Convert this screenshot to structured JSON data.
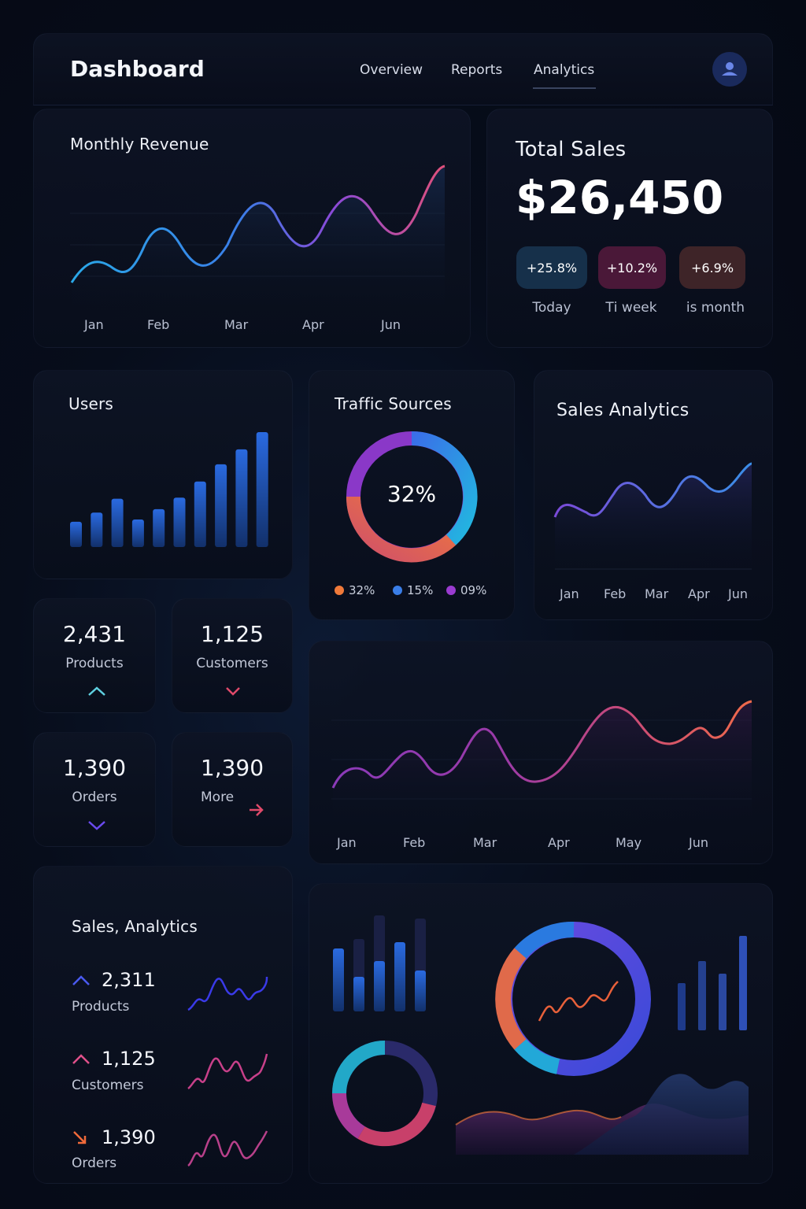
{
  "header": {
    "title": "Dashboard",
    "nav": [
      "Overview",
      "Reports",
      "Analytics"
    ],
    "active_nav": "Analytics",
    "avatar_icon": "user-icon"
  },
  "monthly_revenue": {
    "title": "Monthly Revenue",
    "months": [
      "Jan",
      "Feb",
      "Mar",
      "Apr",
      "Jun"
    ]
  },
  "total_sales": {
    "title": "Total Sales",
    "value": "$26,450",
    "changes": [
      {
        "value": "+25.8%",
        "label": "Today",
        "color": "#16304a"
      },
      {
        "value": "+10.2%",
        "label": "Ti̇ week",
        "color": "#4a1838"
      },
      {
        "value": "+6.9%",
        "label": "is month",
        "color": "#3e2428"
      }
    ]
  },
  "users": {
    "title": "Users",
    "bar_levels": [
      0.22,
      0.3,
      0.42,
      0.24,
      0.33,
      0.43,
      0.57,
      0.72,
      0.85,
      1.0
    ]
  },
  "traffic_sources": {
    "title": "Traffic Sources",
    "center_value": "32%",
    "legend": [
      {
        "label": "32%",
        "color": "#f07a3a"
      },
      {
        "label": "15%",
        "color": "#3a7ee8"
      },
      {
        "label": "09%",
        "color": "#9a3bd0"
      }
    ]
  },
  "sales_analytics_chart": {
    "title": "Sales Analytics",
    "months": [
      "Jan",
      "Feb",
      "Mar",
      "Apr",
      "Jun"
    ]
  },
  "stats": [
    {
      "value": "2,431",
      "label": "Products",
      "icon": "chevron-up-icon",
      "color": "#5fd0e0"
    },
    {
      "value": "1,125",
      "label": "Customers",
      "icon": "chevron-down-icon",
      "color": "#e04a6a"
    },
    {
      "value": "1,390",
      "label": "Orders",
      "icon": "chevron-down-icon",
      "color": "#6a4af0"
    },
    {
      "value": "1,390",
      "label": "More",
      "icon": "arrow-right-icon",
      "color": "#e04a6a"
    }
  ],
  "wide_chart": {
    "months": [
      "Jan",
      "Feb",
      "Mar",
      "Apr",
      "May",
      "Jun"
    ]
  },
  "sales_analytics_list": {
    "title": "Sales, Analytics",
    "items": [
      {
        "value": "2,311",
        "label": "Products",
        "icon": "arrow-up-icon",
        "color": "#4a5af0"
      },
      {
        "value": "1,125",
        "label": "Customers",
        "icon": "arrow-up-icon",
        "color": "#e0508a"
      },
      {
        "value": "1,390",
        "label": "Orders",
        "icon": "arrow-down-right-icon",
        "color": "#f06a3a"
      }
    ]
  }
}
